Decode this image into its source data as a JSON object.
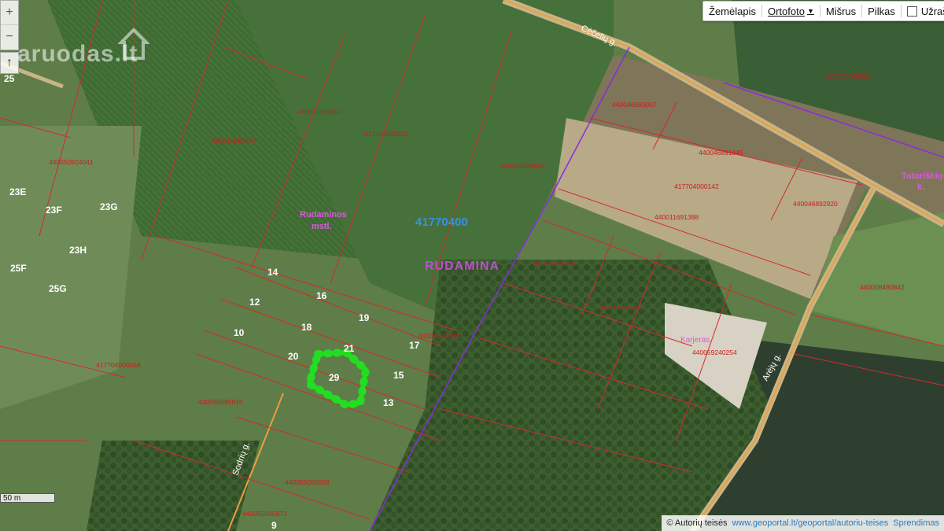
{
  "toolbar": {
    "layers": [
      {
        "label": "Žemėlapis",
        "active": false
      },
      {
        "label": "Ortofoto",
        "active": true
      },
      {
        "label": "Mišrus",
        "active": false
      },
      {
        "label": "Pilkas",
        "active": false
      }
    ],
    "notes_label": "Užrašai"
  },
  "zoom": {
    "in": "+",
    "out": "−"
  },
  "north_arrow": "↑",
  "watermark": "aruodas.lt",
  "scale_label": "50 m",
  "attribution": {
    "copyright": "© Autorių teisės",
    "link": "www.geoportal.lt/geoportal/autoriu-teises",
    "terms": "Sprendimas"
  },
  "place_labels": {
    "block_code": "41770400",
    "area_name": "RUDAMINA",
    "settlement": [
      "Rudaminos",
      "mstl."
    ],
    "village": [
      "Totoriškių",
      "k."
    ],
    "quarry": "Karjeras"
  },
  "street_labels": [
    "Cėčelių g.",
    "Sodrių g.",
    "Arėjų g."
  ],
  "selected_plot": "29",
  "plot_numbers": [
    "25",
    "23E",
    "23F",
    "23G",
    "23H",
    "25F",
    "25G",
    "14",
    "12",
    "16",
    "10",
    "18",
    "19",
    "20",
    "21",
    "17",
    "15",
    "13",
    "9"
  ],
  "parcel_ids": [
    "440046893007",
    "440046891645",
    "417704000142",
    "440046892920",
    "440011691388",
    "417704000035",
    "440009490842",
    "440059240254",
    "417704000058",
    "440055095915",
    "440055095958",
    "417704000102",
    "440054089550",
    "440011683420",
    "440011695951",
    "440050924041",
    "440059240170",
    "440055095931",
    "440059240249",
    "440055095973"
  ],
  "colors": {
    "parcel_line": "#d42a2a",
    "parcel_text": "#c81e1e",
    "district_boundary": "#8a2be2",
    "road": "#e8a040",
    "selection": "#22dd22",
    "block_code": "#3b8fe0",
    "area_name": "#c24bd6",
    "settlement": "#d85adc"
  }
}
